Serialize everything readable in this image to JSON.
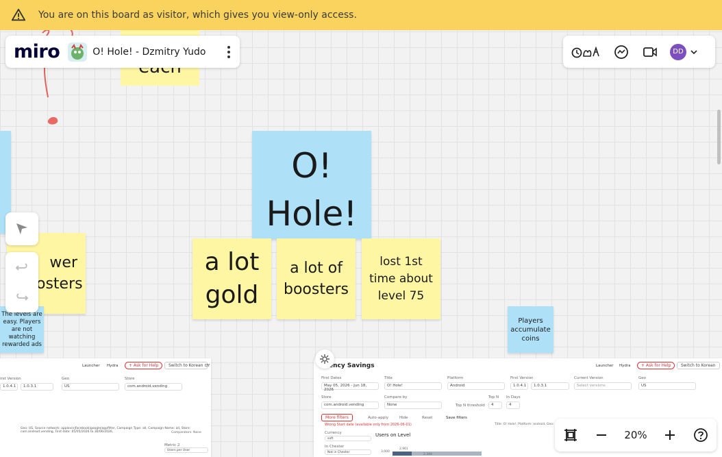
{
  "banner": {
    "text": "You are on this board as visitor, which gives you view-only access."
  },
  "board": {
    "logo": "miro",
    "title": "O! Hole! - Dzmitry Yudo"
  },
  "user": {
    "initials": "DD",
    "color": "#7b4fbd"
  },
  "zoom": {
    "level": "20%"
  },
  "stickies": {
    "top_partial": "each",
    "main_title": "O! Hole!",
    "gold": "a lot gold",
    "boosters": "a lot of boosters",
    "lost": "lost 1st time about level 75",
    "left_partial": "wer osters",
    "levels": "The levels are easy. Players are not watching rewarded ads",
    "coins": "Players accumulate coins"
  },
  "embed_left": {
    "launcher": "Launcher",
    "hydra": "Hydra",
    "ask_help": "+ Ask for Help",
    "switch": "Switch to Korean",
    "dy": "DY",
    "first_version_label": "irst Version",
    "v1": "1.0.4.1",
    "v2": "1.0.3.1",
    "geo_label": "Geo",
    "geo": "US",
    "store_label": "Store",
    "store": "com.android.vending",
    "filters_line": "Geo: US, Source network: applovin|facebook|google|appfilter, Campaign Type: all, Campaign Name: all, Store: com.android.vending, First date: 05/05/2026 to 30/06/2026,",
    "comparators": "Comparators: None",
    "metric_label": "Metric 2",
    "metric": "Users per User"
  },
  "embed_right": {
    "title": "ency Savings",
    "launcher": "Launcher",
    "hydra": "Hydra",
    "ask_help": "+ Ask for Help",
    "switch": "Switch to Korean",
    "first_dates_label": "First Dates",
    "first_dates": "May 05, 2026 - Jun 18, 2026",
    "title_label": "Title",
    "title_value": "O! Hole!",
    "platform_label": "Platform",
    "platform": "Android",
    "first_version_label": "First Version",
    "v1": "1.0.4.1",
    "v2": "1.0.3.1",
    "current_version_label": "Current Version",
    "current_version": "Select versions",
    "geo_label": "Geo",
    "geo": "US",
    "store_label": "Store",
    "store": "com.android.vending",
    "compare_label": "Compare by",
    "compare": "None",
    "topn_toggle": "Top N threshold",
    "topn_label": "Top N",
    "topn": "4",
    "indays_label": "In Days",
    "indays": "4",
    "more_filters": "More filters",
    "auto_apply": "Auto-apply",
    "hide": "Hide",
    "reset": "Reset",
    "save_filters": "Save filters",
    "warning": "Wrong Start date (available only from 2026-06-01)",
    "context": "Title: O! Hole!, Platform: android, Geo: US",
    "currency_label": "Currency",
    "currency": "soft",
    "in_chester_label": "In Chester",
    "in_chester": "Not in Chester",
    "chart_title": "Users on Level",
    "bar1": "2,961",
    "bar2": "2,344",
    "axis": "3,000"
  }
}
